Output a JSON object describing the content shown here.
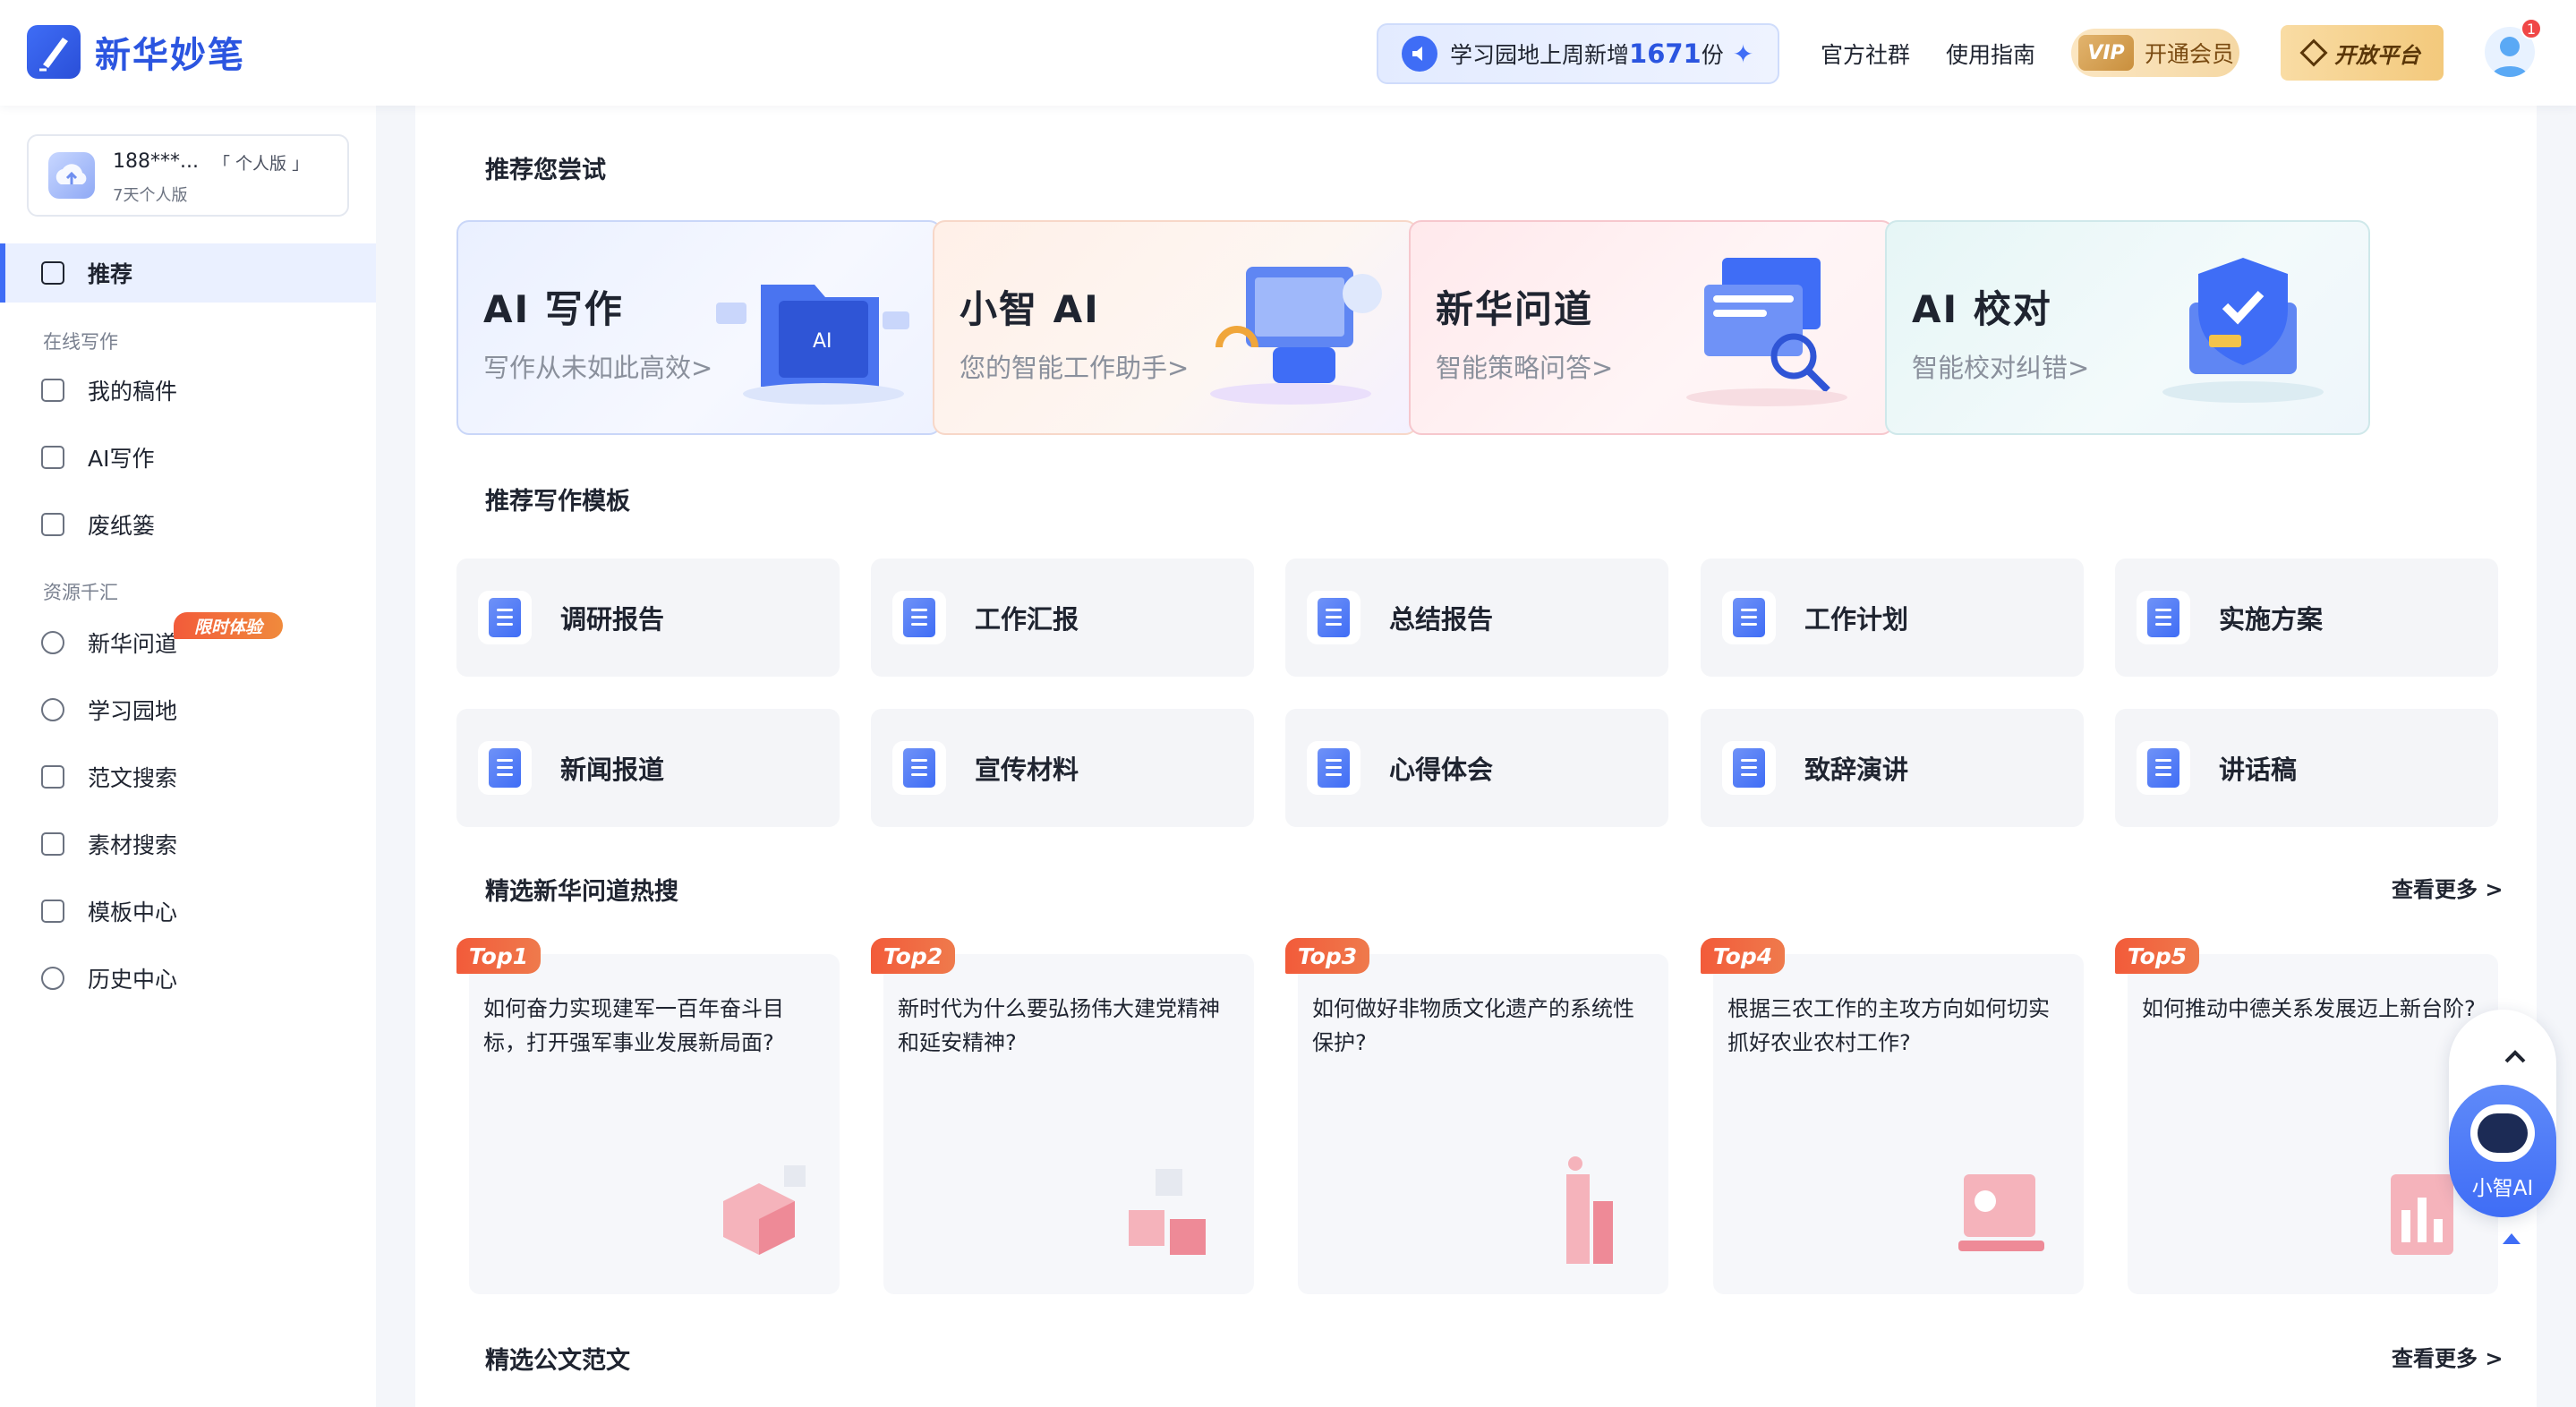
{
  "header": {
    "logo_text": "新华妙笔",
    "notice": {
      "prefix": "学习园地上周新增",
      "count": "1671",
      "suffix": "份"
    },
    "links": [
      "官方社群",
      "使用指南"
    ],
    "vip": {
      "badge": "VIP",
      "label": "开通会员"
    },
    "open_platform": "开放平台",
    "notification_count": "1"
  },
  "sidebar": {
    "account": {
      "phone": "188***...",
      "edition": "「 个人版 」",
      "sub": "7天个人版"
    },
    "active": "推荐",
    "sections": [
      {
        "title": "在线写作",
        "items": [
          "我的稿件",
          "AI写作",
          "废纸篓"
        ]
      },
      {
        "title": "资源千汇",
        "items": [
          "新华问道",
          "学习园地",
          "范文搜索",
          "素材搜索",
          "模板中心",
          "历史中心"
        ]
      }
    ],
    "limited_badge": "限时体验"
  },
  "main": {
    "recommend": {
      "title": "推荐您尝试",
      "cards": [
        {
          "title": "AI 写作",
          "sub": "写作从未如此高效>"
        },
        {
          "title": "小智 AI",
          "sub": "您的智能工作助手>"
        },
        {
          "title": "新华问道",
          "sub": "智能策略问答>"
        },
        {
          "title": "AI 校对",
          "sub": "智能校对纠错>"
        }
      ]
    },
    "templates": {
      "title": "推荐写作模板",
      "items": [
        "调研报告",
        "工作汇报",
        "总结报告",
        "工作计划",
        "实施方案",
        "新闻报道",
        "宣传材料",
        "心得体会",
        "致辞演讲",
        "讲话稿"
      ]
    },
    "hot": {
      "title": "精选新华问道热搜",
      "more": "查看更多 >",
      "items": [
        {
          "badge": "Top1",
          "q": "如何奋力实现建军一百年奋斗目标，打开强军事业发展新局面?"
        },
        {
          "badge": "Top2",
          "q": "新时代为什么要弘扬伟大建党精神和延安精神?"
        },
        {
          "badge": "Top3",
          "q": "如何做好非物质文化遗产的系统性保护?"
        },
        {
          "badge": "Top4",
          "q": "根据三农工作的主攻方向如何切实抓好农业农村工作?"
        },
        {
          "badge": "Top5",
          "q": "如何推动中德关系发展迈上新台阶?"
        }
      ]
    },
    "essays": {
      "title": "精选公文范文",
      "more": "查看更多 >"
    }
  },
  "float": {
    "label": "小智AI"
  },
  "colors": {
    "accent": "#3f6df6",
    "badge": "#f25b3a"
  }
}
